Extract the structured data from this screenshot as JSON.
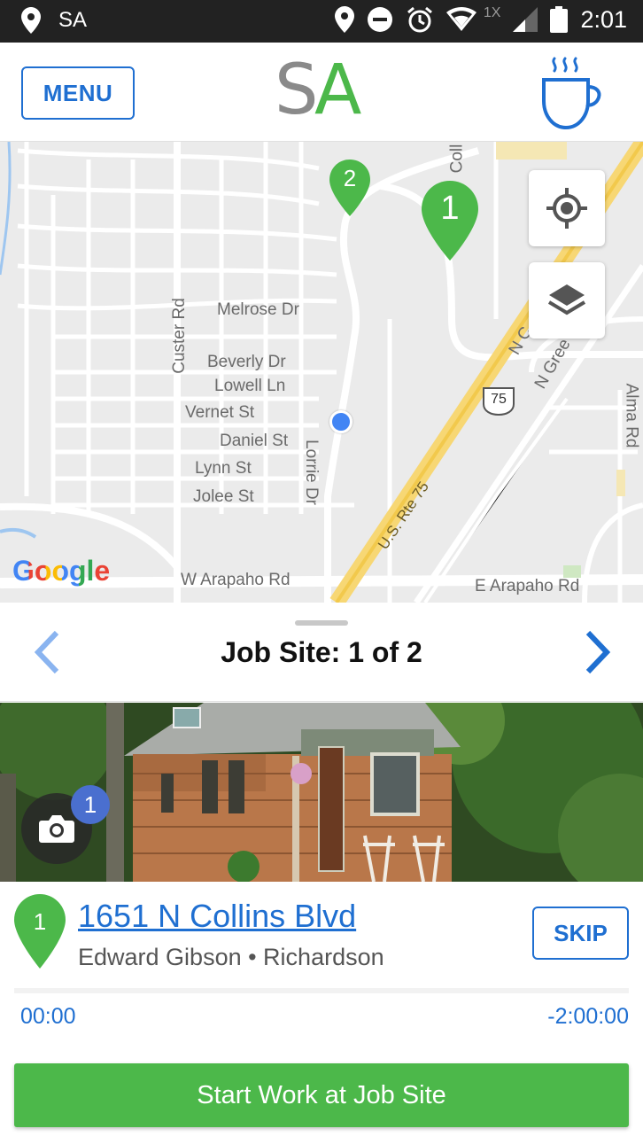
{
  "status_bar": {
    "carrier": "SA",
    "time": "2:01",
    "network_badge": "1X",
    "icons": [
      "location-icon",
      "do-not-disturb-icon",
      "alarm-icon",
      "wifi-icon",
      "signal-icon",
      "battery-icon"
    ]
  },
  "header": {
    "menu_label": "MENU",
    "logo_left": "S",
    "logo_right": "A",
    "coffee_icon": "coffee-cup-icon"
  },
  "colors": {
    "accent_blue": "#1f6fd1",
    "brand_green": "#4cb84a",
    "logo_gray": "#8a8a8a",
    "user_location": "#4285f4"
  },
  "map": {
    "labels": {
      "melrose": "Melrose Dr",
      "beverly": "Beverly Dr",
      "lowell": "Lowell Ln",
      "vernet": "Vernet St",
      "daniel": "Daniel St",
      "lynn": "Lynn St",
      "jolee": "Jolee St",
      "custer": "Custer Rd",
      "lorrie": "Lorrie Dr",
      "w_arapaho": "W Arapaho Rd",
      "e_arapaho": "E Arapaho Rd",
      "alma": "Alma Rd",
      "us75": "U.S. Rte 75",
      "shield": "75",
      "coll": "Coll",
      "n_c": "N C",
      "n_green": "N Gree",
      "google": "Google"
    },
    "pins": [
      {
        "number": "1"
      },
      {
        "number": "2"
      }
    ]
  },
  "jobsite": {
    "title": "Job Site: 1 of 2"
  },
  "photo": {
    "count": "1"
  },
  "job": {
    "pin_number": "1",
    "address": "1651 N Collins Blvd",
    "subtitle": "Edward Gibson • Richardson",
    "skip_label": "SKIP",
    "timer_elapsed": "00:00",
    "timer_remaining": "-2:00:00",
    "start_label": "Start Work at Job Site"
  }
}
